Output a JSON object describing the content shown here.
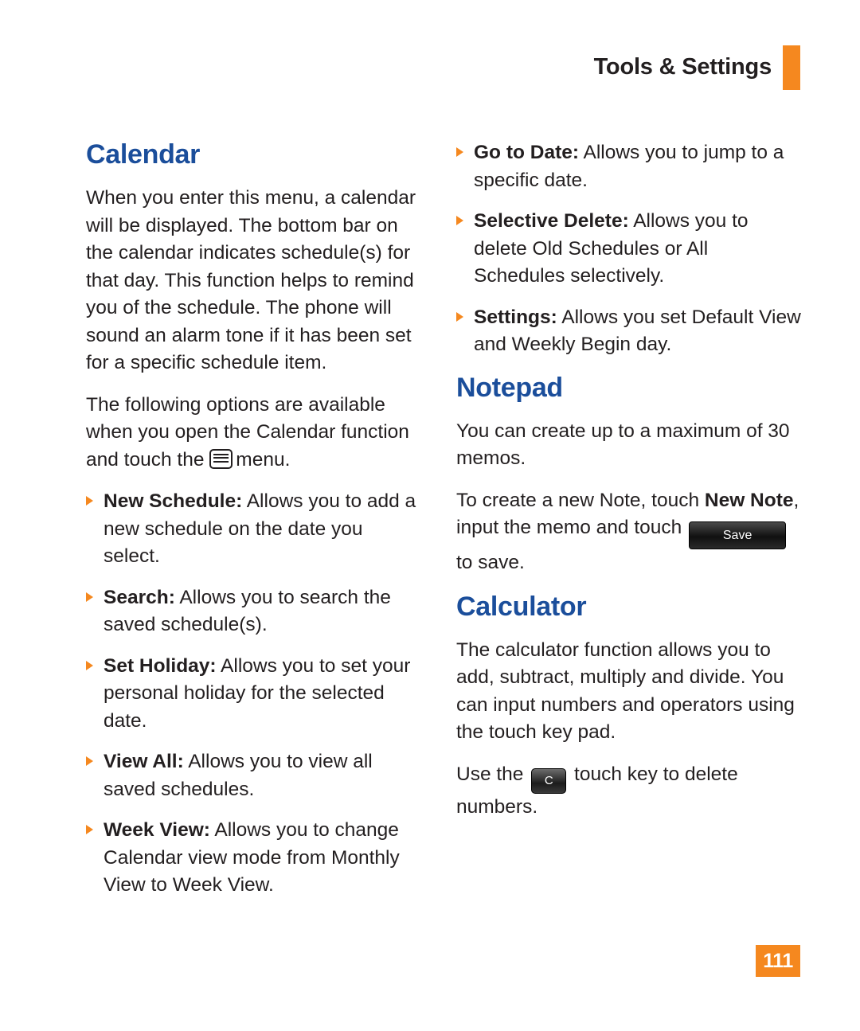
{
  "header": {
    "title": "Tools & Settings",
    "accent_color": "#f5881f"
  },
  "left_column": {
    "heading": "Calendar",
    "paragraphs": [
      "When you enter this menu, a calendar will be displayed. The bottom bar on the calendar indicates schedule(s) for that day. This function helps to remind you of the schedule. The phone will sound an alarm tone if it has been set for a specific schedule item."
    ],
    "intro_before_icon": "The following options are available when you open the Calendar function and touch the ",
    "intro_after_icon": "menu.",
    "bullets": [
      {
        "term": "New Schedule:",
        "text": " Allows you to add a new schedule on the date you select."
      },
      {
        "term": "Search:",
        "text": " Allows you to search the saved schedule(s)."
      },
      {
        "term": "Set Holiday:",
        "text": " Allows you to set your personal holiday for the selected date."
      },
      {
        "term": "View All:",
        "text": " Allows you to view all saved schedules."
      },
      {
        "term": "Week View:",
        "text": " Allows you to change Calendar view mode from Monthly View to Week View."
      }
    ]
  },
  "right_column": {
    "bullets": [
      {
        "term": "Go to Date:",
        "text": " Allows you to jump to a specific date."
      },
      {
        "term": "Selective Delete:",
        "text": " Allows you to delete Old Schedules or All Schedules selectively."
      },
      {
        "term": "Settings:",
        "text": " Allows you set Default View and Weekly Begin day."
      }
    ],
    "notepad": {
      "heading": "Notepad",
      "paragraph": "You can create up to a maximum of 30 memos.",
      "note_line_1": "To create a new Note, touch ",
      "note_bold": "New Note",
      "note_line_2": ", input the memo and touch ",
      "save_key_label": "Save",
      "note_line_3": "to save."
    },
    "calculator": {
      "heading": "Calculator",
      "paragraph": "The calculator function allows you to add, subtract, multiply and divide. You can input numbers and operators using the touch key pad.",
      "use_prefix": "Use the ",
      "clear_key_label": "C",
      "use_suffix": " touch key to delete numbers."
    }
  },
  "footer": {
    "page_number": "111"
  }
}
